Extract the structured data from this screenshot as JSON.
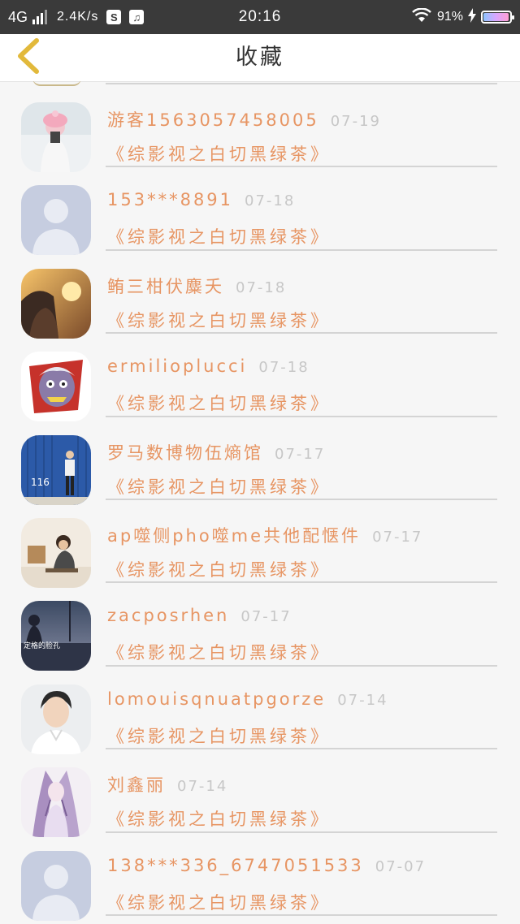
{
  "status_bar": {
    "network": "4G",
    "speed": "2.4K/s",
    "app_icon_1": "S",
    "app_icon_2": "♫",
    "time": "20:16",
    "battery": "91%"
  },
  "header": {
    "title": "收藏",
    "back_icon": "chevron-left-icon"
  },
  "colors": {
    "accent": "#e79563",
    "date_gray": "#c7c7c7",
    "back_arrow": "#e2b93b"
  },
  "items": [
    {
      "name": "游客1563057458005",
      "date": "07-19",
      "book": "《综影视之白切黑绿茶》",
      "avatar": "photo-girl-pink-hat"
    },
    {
      "name": "153***8891",
      "date": "07-18",
      "book": "《综影视之白切黑绿茶》",
      "avatar": "default-avatar"
    },
    {
      "name": "鲔三柑伏麋夭",
      "date": "07-18",
      "book": "《综影视之白切黑绿茶》",
      "avatar": "photo-sunset-girl"
    },
    {
      "name": "ermilioplucci",
      "date": "07-18",
      "book": "《综影视之白切黑绿茶》",
      "avatar": "cartoon-zombie"
    },
    {
      "name": "罗马数博物伍熵馆",
      "date": "07-17",
      "book": "《综影视之白切黑绿茶》",
      "avatar": "photo-blue-container",
      "avatar_text": "116"
    },
    {
      "name": "ap噬侧pho噬me共他配惬件",
      "date": "07-17",
      "book": "《综影视之白切黑绿茶》",
      "avatar": "photo-boy-room"
    },
    {
      "name": "zacposrhen",
      "date": "07-17",
      "book": "《综影视之白切黑绿茶》",
      "avatar": "photo-dusk-figure",
      "avatar_text": "定格的脸孔"
    },
    {
      "name": "lomouisqnuatpgorze",
      "date": "07-14",
      "book": "《综影视之白切黑绿茶》",
      "avatar": "photo-boy-white-shirt"
    },
    {
      "name": "刘鑫丽",
      "date": "07-14",
      "book": "《综影视之白切黑绿茶》",
      "avatar": "illustration-purple-hair"
    },
    {
      "name": "138***336_6747051533",
      "date": "07-07",
      "book": "《综影视之白切黑绿茶》",
      "avatar": "default-avatar"
    }
  ]
}
